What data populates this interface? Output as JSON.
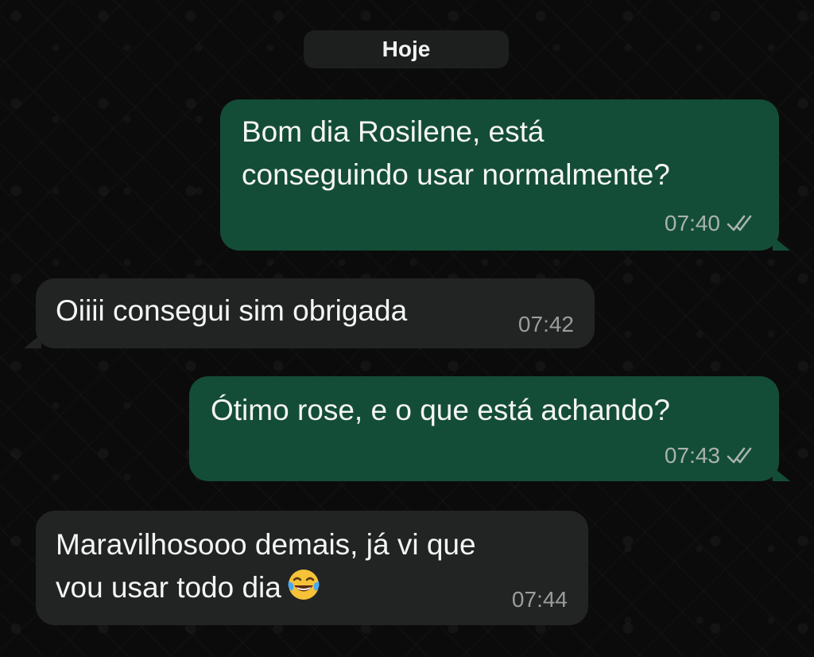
{
  "date_separator": "Hoje",
  "messages": [
    {
      "direction": "outgoing",
      "text": "Bom dia Rosilene, está\nconseguindo usar normalmente?",
      "time": "07:40",
      "status_icon": "double-check-icon"
    },
    {
      "direction": "incoming",
      "text": "Oiiii consegui sim obrigada",
      "time": "07:42"
    },
    {
      "direction": "outgoing",
      "text": "Ótimo rose, e o que está achando?",
      "time": "07:43",
      "status_icon": "double-check-icon"
    },
    {
      "direction": "incoming",
      "text_line1": "Maravilhosooo demais, já vi que",
      "text_line2": "vou usar todo dia",
      "emoji": "tears-of-joy-emoji",
      "time": "07:44"
    }
  ],
  "colors": {
    "background": "#0b0b0b",
    "outgoing_bubble": "#144d37",
    "incoming_bubble": "#222424",
    "date_pill": "#1d1f1f"
  }
}
